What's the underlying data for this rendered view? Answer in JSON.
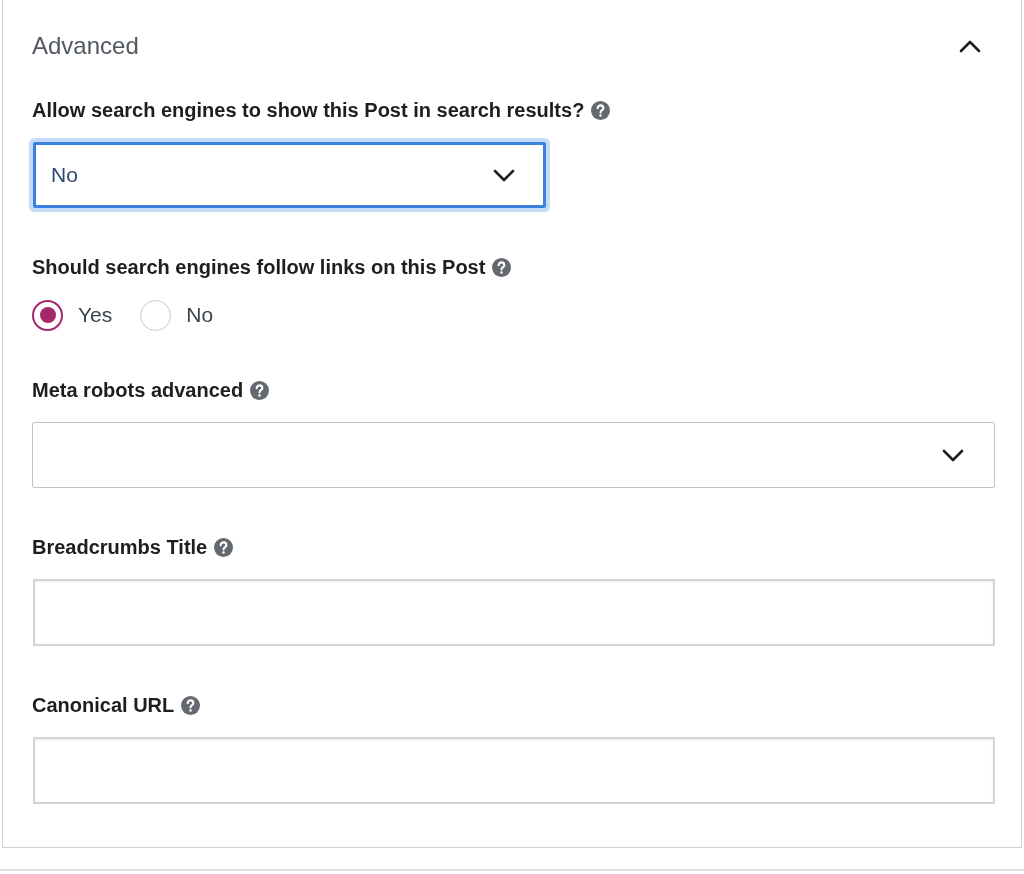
{
  "panel": {
    "title": "Advanced",
    "expanded": true
  },
  "fields": [
    {
      "kind": "select",
      "label": "Allow search engines to show this Post in search results?",
      "value": "No",
      "focused": true
    },
    {
      "kind": "radio",
      "label": "Should search engines follow links on this Post",
      "options": [
        {
          "label": "Yes",
          "selected": true
        },
        {
          "label": "No",
          "selected": false
        }
      ]
    },
    {
      "kind": "select",
      "label": "Meta robots advanced",
      "focused": false
    },
    {
      "kind": "text",
      "label": "Breadcrumbs Title"
    },
    {
      "kind": "text",
      "label": "Canonical URL"
    }
  ]
}
